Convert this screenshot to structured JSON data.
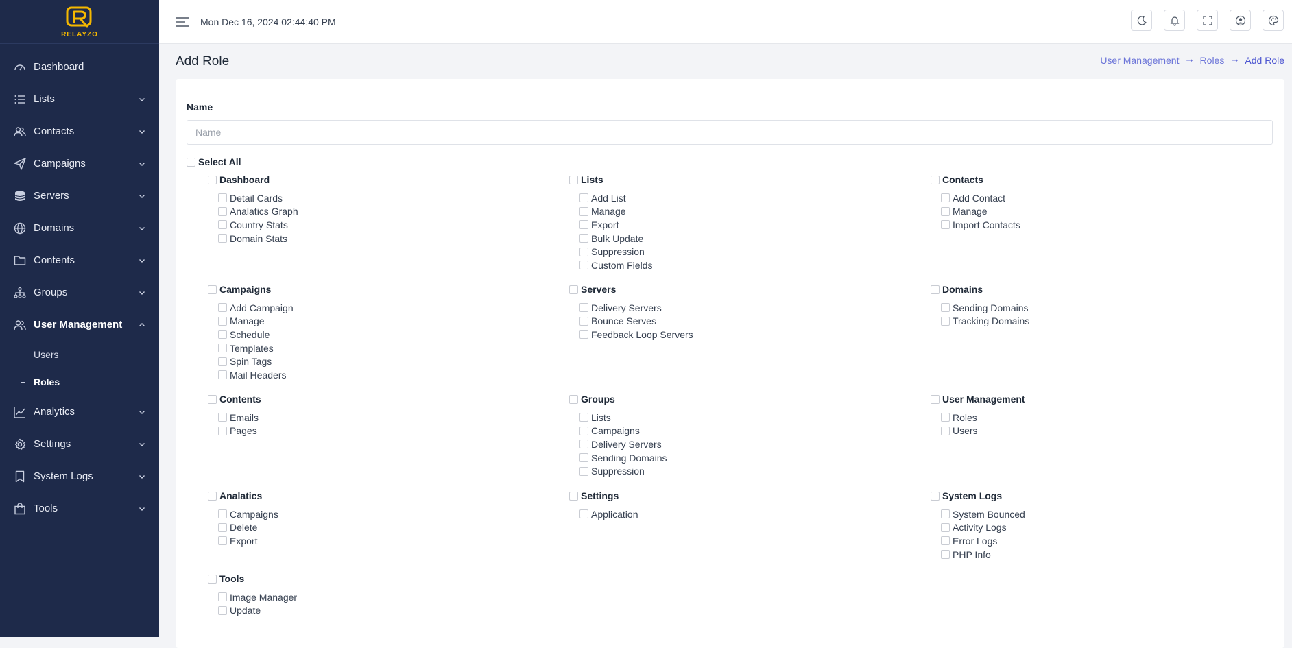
{
  "brand": {
    "name": "RELAYZO",
    "color": "#f5b800"
  },
  "sidebar": {
    "items": [
      {
        "label": "Dashboard",
        "icon": "dashboard-gauge-icon",
        "expandable": false
      },
      {
        "label": "Lists",
        "icon": "list-icon",
        "expandable": true
      },
      {
        "label": "Contacts",
        "icon": "users-icon",
        "expandable": true
      },
      {
        "label": "Campaigns",
        "icon": "send-icon",
        "expandable": true
      },
      {
        "label": "Servers",
        "icon": "database-icon",
        "expandable": true
      },
      {
        "label": "Domains",
        "icon": "globe-icon",
        "expandable": true
      },
      {
        "label": "Contents",
        "icon": "folder-icon",
        "expandable": true
      },
      {
        "label": "Groups",
        "icon": "hierarchy-icon",
        "expandable": true
      },
      {
        "label": "User Management",
        "icon": "users-icon",
        "expandable": true,
        "expanded": true,
        "active": true
      },
      {
        "label": "Analytics",
        "icon": "chart-line-icon",
        "expandable": true
      },
      {
        "label": "Settings",
        "icon": "gear-icon",
        "expandable": true
      },
      {
        "label": "System Logs",
        "icon": "bookmark-icon",
        "expandable": true
      },
      {
        "label": "Tools",
        "icon": "shopping-bag-icon",
        "expandable": true
      }
    ],
    "user_management_sub": [
      {
        "label": "Users",
        "active": false
      },
      {
        "label": "Roles",
        "active": true
      }
    ]
  },
  "topbar": {
    "datetime": "Mon Dec 16, 2024 02:44:40 PM",
    "actions": [
      "moon-icon",
      "bell-icon",
      "fullscreen-icon",
      "user-circle-icon",
      "palette-icon"
    ]
  },
  "page": {
    "title": "Add Role",
    "breadcrumb": [
      "User Management",
      "Roles",
      "Add Role"
    ]
  },
  "form": {
    "name_label": "Name",
    "name_placeholder": "Name",
    "name_value": "",
    "select_all_label": "Select All",
    "groups": [
      {
        "title": "Dashboard",
        "perms": [
          "Detail Cards",
          "Analatics Graph",
          "Country Stats",
          "Domain Stats"
        ]
      },
      {
        "title": "Lists",
        "perms": [
          "Add List",
          "Manage",
          "Export",
          "Bulk Update",
          "Suppression",
          "Custom Fields"
        ]
      },
      {
        "title": "Contacts",
        "perms": [
          "Add Contact",
          "Manage",
          "Import Contacts"
        ]
      },
      {
        "title": "Campaigns",
        "perms": [
          "Add Campaign",
          "Manage",
          "Schedule",
          "Templates",
          "Spin Tags",
          "Mail Headers"
        ]
      },
      {
        "title": "Servers",
        "perms": [
          "Delivery Servers",
          "Bounce Serves",
          "Feedback Loop Servers"
        ]
      },
      {
        "title": "Domains",
        "perms": [
          "Sending Domains",
          "Tracking Domains"
        ]
      },
      {
        "title": "Contents",
        "perms": [
          "Emails",
          "Pages"
        ]
      },
      {
        "title": "Groups",
        "perms": [
          "Lists",
          "Campaigns",
          "Delivery Servers",
          "Sending Domains",
          "Suppression"
        ]
      },
      {
        "title": "User Management",
        "perms": [
          "Roles",
          "Users"
        ]
      },
      {
        "title": "Analatics",
        "perms": [
          "Campaigns",
          "Delete",
          "Export"
        ]
      },
      {
        "title": "Settings",
        "perms": [
          "Application"
        ]
      },
      {
        "title": "System Logs",
        "perms": [
          "System Bounced",
          "Activity Logs",
          "Error Logs",
          "PHP Info"
        ]
      },
      {
        "title": "Tools",
        "perms": [
          "Image Manager",
          "Update"
        ]
      }
    ]
  },
  "colors": {
    "sidebar_bg": "#1e2a4a",
    "accent": "#4c55d1",
    "page_bg": "#f3f4f7"
  }
}
